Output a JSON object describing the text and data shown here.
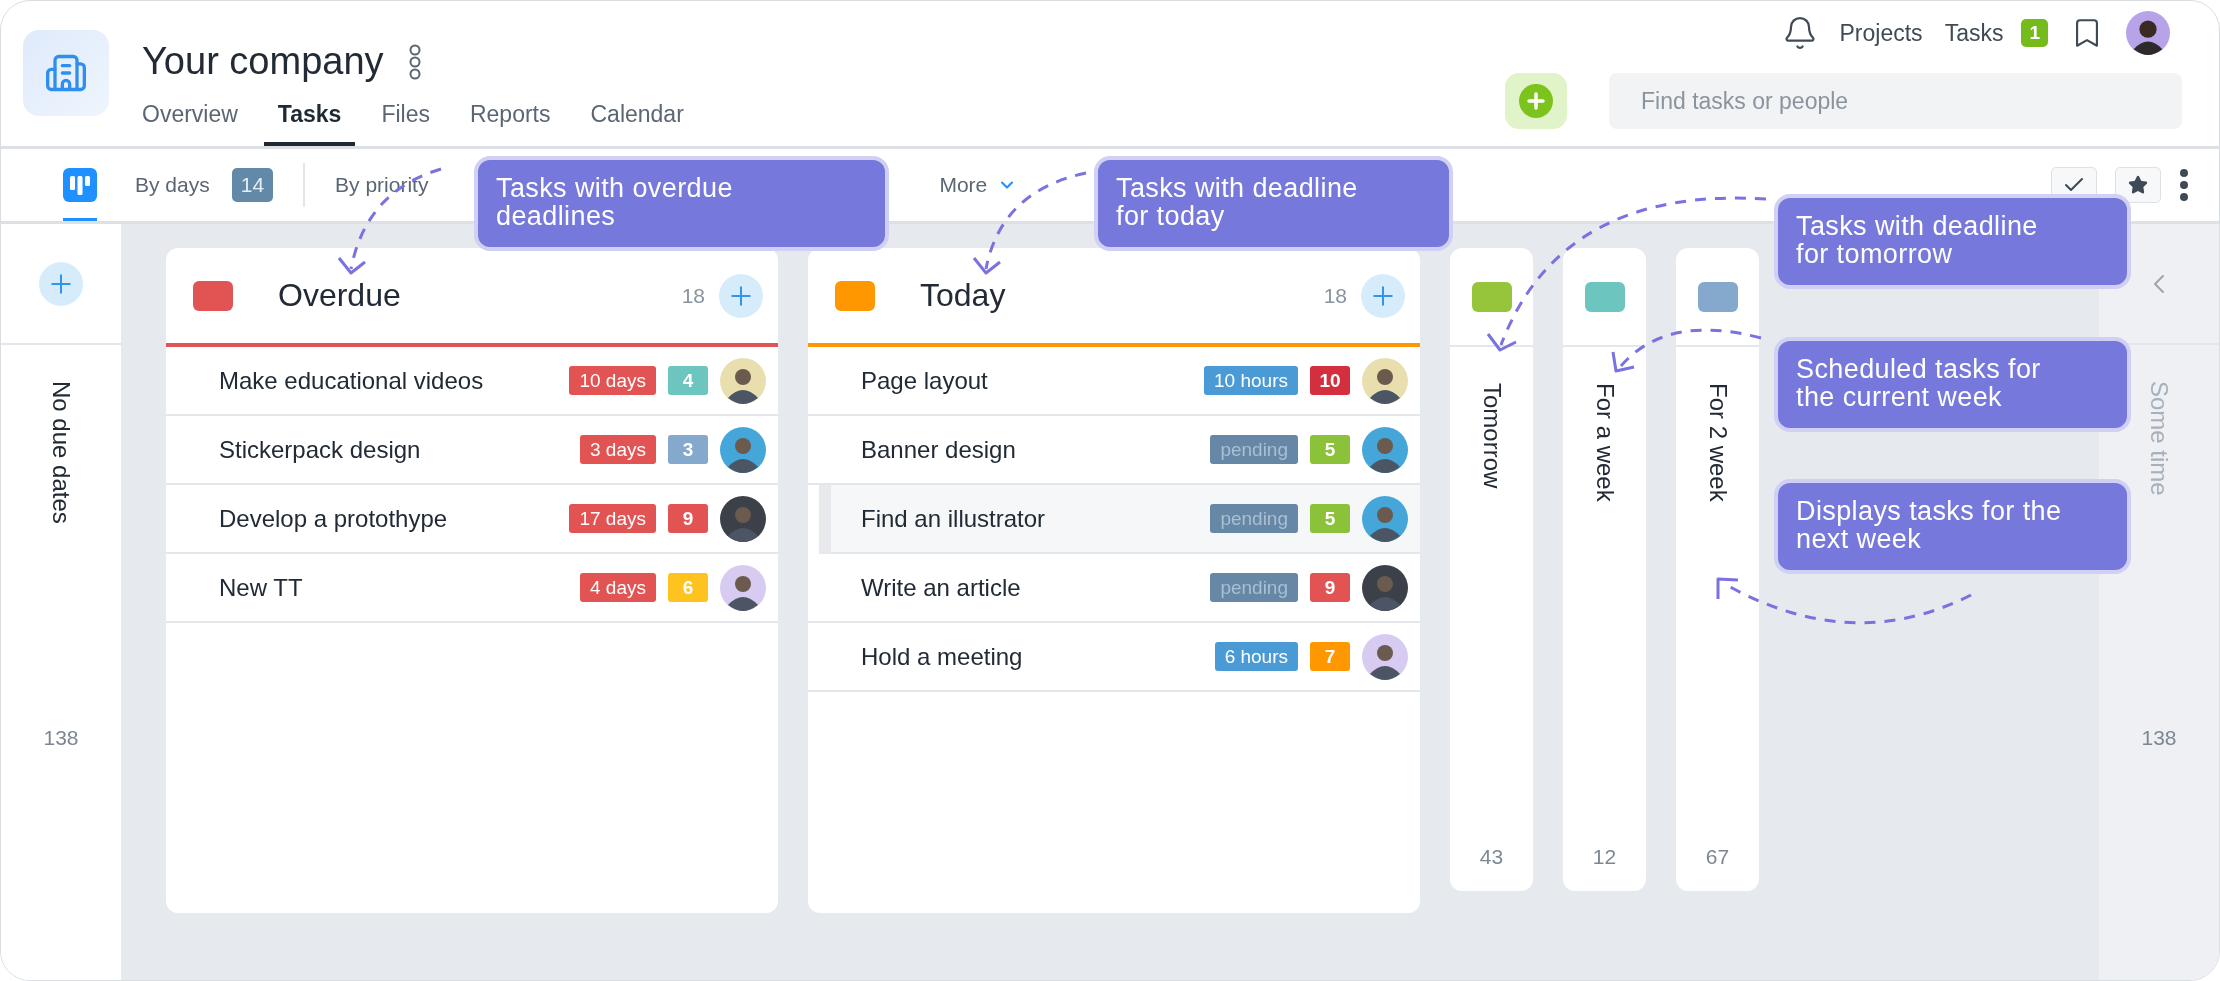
{
  "company": {
    "name": "Your company"
  },
  "nav_tabs": [
    {
      "label": "Overview",
      "selected": false
    },
    {
      "label": "Tasks",
      "selected": true
    },
    {
      "label": "Files",
      "selected": false
    },
    {
      "label": "Reports",
      "selected": false
    },
    {
      "label": "Calendar",
      "selected": false
    }
  ],
  "top_links": [
    "Projects",
    "Tasks"
  ],
  "notification_count": "1",
  "search": {
    "placeholder": "Find tasks or people"
  },
  "view_tabs": [
    {
      "kind": "board",
      "selected": true
    },
    {
      "kind": "text",
      "label": "By days",
      "count": "14",
      "selected": false
    },
    {
      "kind": "text",
      "label": "By priority",
      "selected": false
    },
    {
      "kind": "dropdown",
      "label": "More",
      "selected": false
    }
  ],
  "unscheduled": {
    "label": "No due dates",
    "count": "138"
  },
  "columns": [
    {
      "kind": "wide",
      "title": "Overdue",
      "color": "#e25454",
      "count": "18",
      "tasks": [
        {
          "title": "Make educational videos",
          "deadline": {
            "kind": "days",
            "text": "10 days"
          },
          "count": {
            "text": "4",
            "color": "#6cc5be"
          },
          "avatar": {
            "color": "#e9dfae"
          },
          "selected": false
        },
        {
          "title": "Stickerpack design",
          "deadline": {
            "kind": "days",
            "text": "3 days"
          },
          "count": {
            "text": "3",
            "color": "#84a9cc"
          },
          "avatar": {
            "color": "#45a6d9"
          },
          "selected": false
        },
        {
          "title": "Develop a protothype",
          "deadline": {
            "kind": "days",
            "text": "17 days"
          },
          "count": {
            "text": "9",
            "color": "#e25454"
          },
          "avatar": {
            "color": "#3b4049"
          },
          "selected": false
        },
        {
          "title": "New TT",
          "deadline": {
            "kind": "days",
            "text": "4 days"
          },
          "count": {
            "text": "6",
            "color": "#ffc31f"
          },
          "avatar": {
            "color": "#d7cbf1"
          },
          "selected": false
        }
      ]
    },
    {
      "kind": "wide",
      "title": "Today",
      "color": "#ff9800",
      "count": "18",
      "tasks": [
        {
          "title": "Page layout",
          "deadline": {
            "kind": "hours",
            "text": "10 hours"
          },
          "count": {
            "text": "10",
            "color": "#d32f3f"
          },
          "avatar": {
            "color": "#e9dfae"
          },
          "selected": false
        },
        {
          "title": "Banner design",
          "deadline": {
            "kind": "pending",
            "text": "pending"
          },
          "count": {
            "text": "5",
            "color": "#8cc13a"
          },
          "avatar": {
            "color": "#45a6d9"
          },
          "selected": false
        },
        {
          "title": "Find an illustrator",
          "deadline": {
            "kind": "pending",
            "text": "pending"
          },
          "count": {
            "text": "5",
            "color": "#8cc13a"
          },
          "avatar": {
            "color": "#45a6d9"
          },
          "selected": true
        },
        {
          "title": "Write an article",
          "deadline": {
            "kind": "pending",
            "text": "pending"
          },
          "count": {
            "text": "9",
            "color": "#e25454"
          },
          "avatar": {
            "color": "#3b4049"
          },
          "selected": false
        },
        {
          "title": "Hold a meeting",
          "deadline": {
            "kind": "hours",
            "text": "6 hours"
          },
          "count": {
            "text": "7",
            "color": "#ff9800"
          },
          "avatar": {
            "color": "#d7cbf1"
          },
          "selected": false
        }
      ]
    },
    {
      "kind": "narrow",
      "title": "Tomorrow",
      "color": "#96c43a",
      "count": "43"
    },
    {
      "kind": "narrow",
      "title": "For a week",
      "color": "#6cc5be",
      "count": "12"
    },
    {
      "kind": "narrow",
      "title": "For 2 week",
      "color": "#84a9cc",
      "count": "67"
    }
  ],
  "later": {
    "label": "Some time",
    "count": "138"
  },
  "callouts": [
    {
      "text": "Tasks with overdue deadlines"
    },
    {
      "text": "Tasks with deadline for today"
    },
    {
      "text": "Tasks with deadline for tomorrow"
    },
    {
      "text": "Scheduled tasks for the current week"
    },
    {
      "text": "Displays tasks for the next week"
    }
  ]
}
